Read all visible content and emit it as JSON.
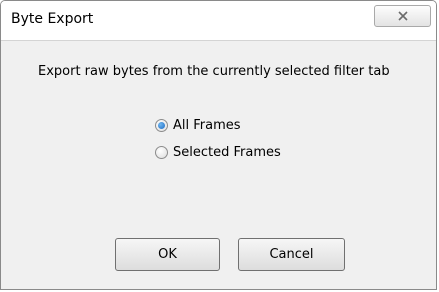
{
  "window": {
    "title": "Byte Export",
    "close_icon": "close-icon"
  },
  "dialog": {
    "message": "Export raw bytes from the currently selected filter tab",
    "options": [
      {
        "label": "All Frames",
        "selected": true
      },
      {
        "label": "Selected Frames",
        "selected": false
      }
    ],
    "ok_label": "OK",
    "cancel_label": "Cancel"
  }
}
